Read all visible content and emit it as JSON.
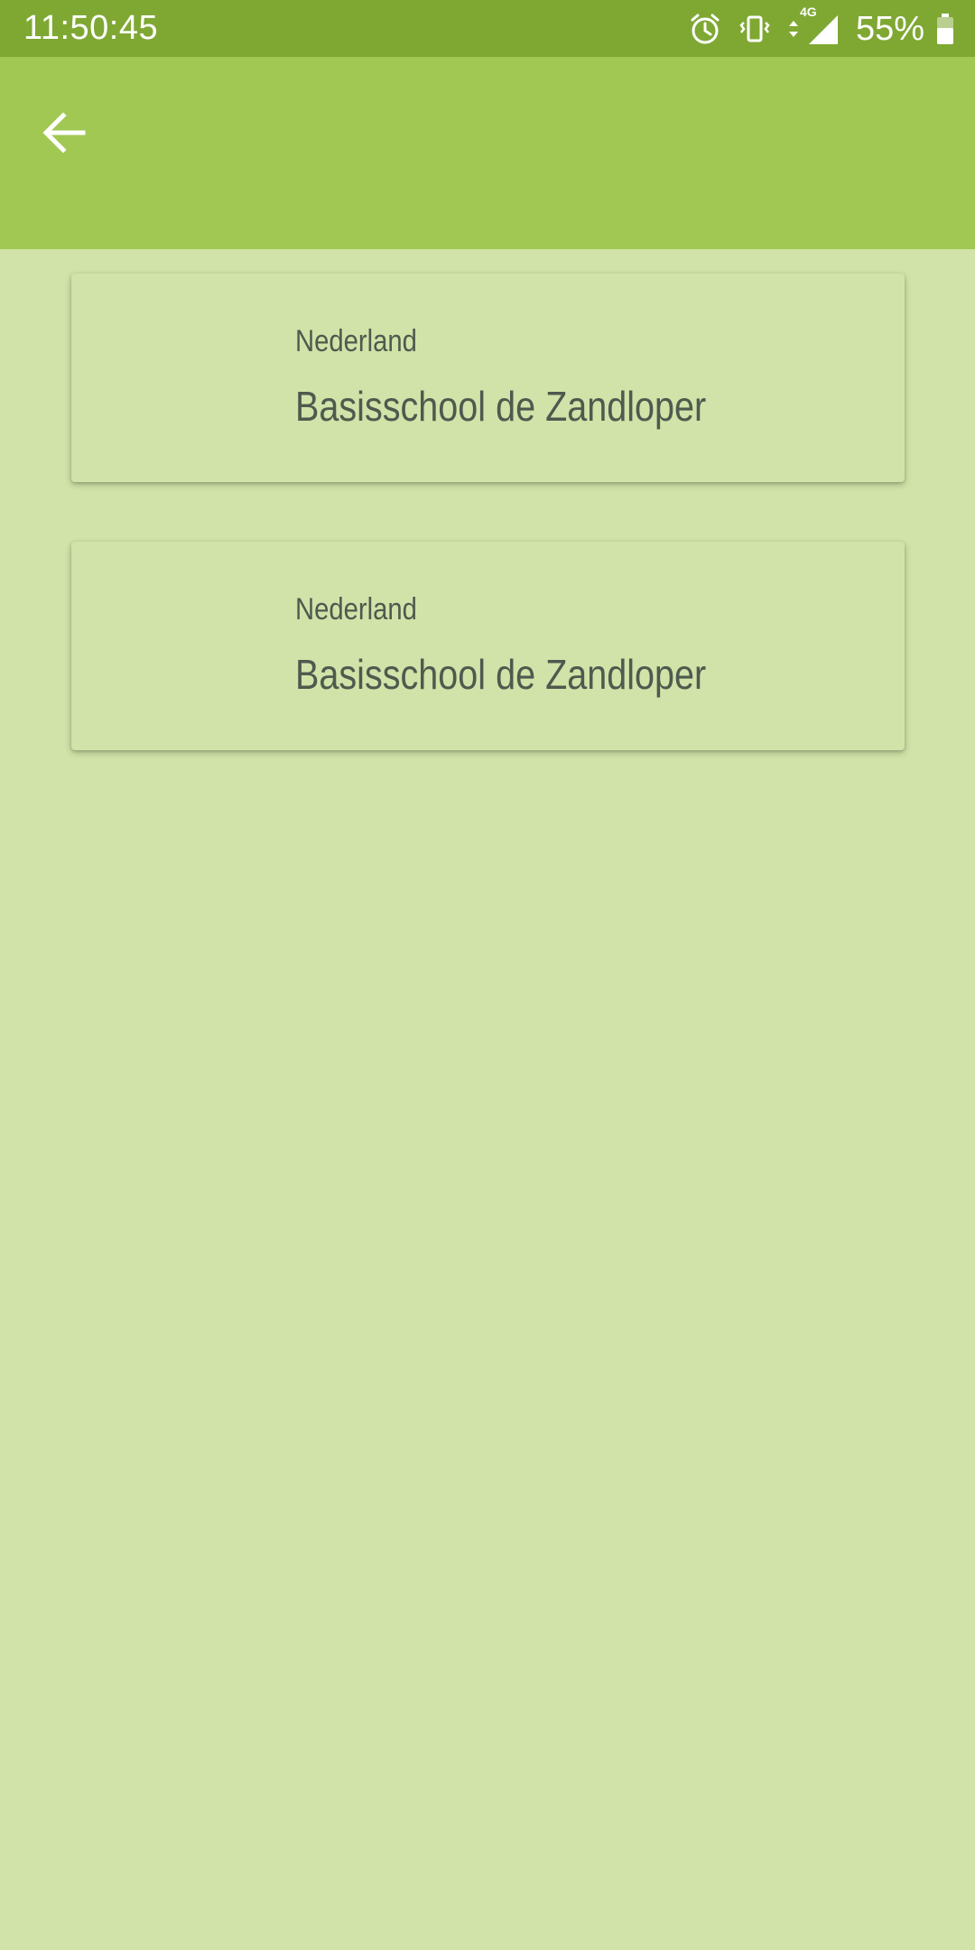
{
  "status_bar": {
    "time": "11:50:45",
    "network": "4G",
    "battery_percent": "55%",
    "icons": [
      "alarm-icon",
      "vibrate-icon",
      "data-arrows-icon",
      "signal-icon",
      "battery-icon"
    ]
  },
  "app_bar": {
    "back_icon": "arrow-left-icon",
    "color": "#a0c853"
  },
  "list": {
    "items": [
      {
        "country": "Nederland",
        "school": "Basisschool de Zandloper"
      },
      {
        "country": "Nederland",
        "school": "Basisschool de Zandloper"
      }
    ]
  },
  "colors": {
    "status_bar": "#7fa833",
    "app_bar": "#a0c853",
    "background": "#d1e3a8",
    "text": "#4e5a4e"
  }
}
